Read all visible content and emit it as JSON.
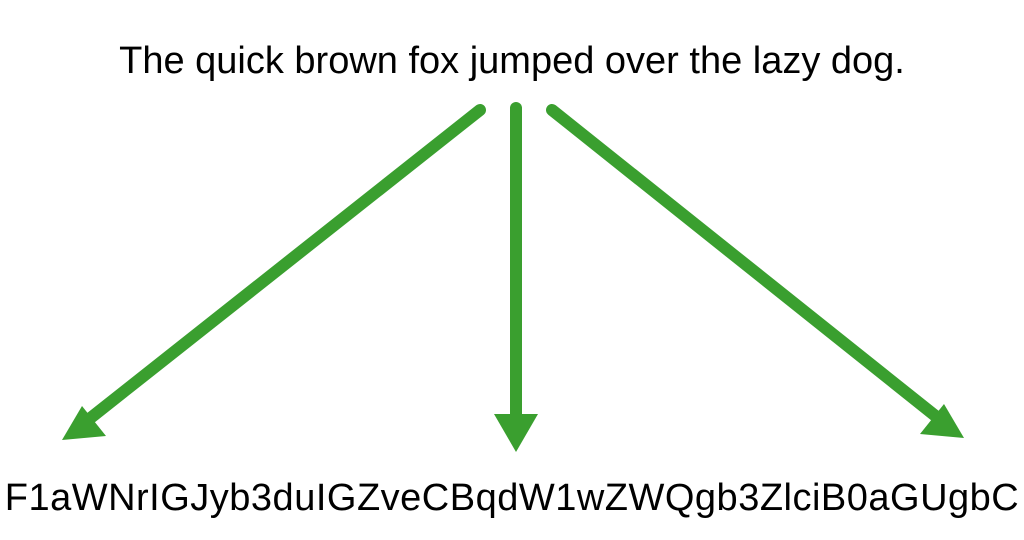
{
  "source_text": "The quick brown fox jumped over the lazy dog.",
  "encoded_text": "F1aWNrIGJyb3duIGZveCBqdW1wZWQgb3ZlciB0aGUgbC",
  "colors": {
    "arrow": "#3a9f2f",
    "text": "#000000",
    "background": "#ffffff"
  }
}
